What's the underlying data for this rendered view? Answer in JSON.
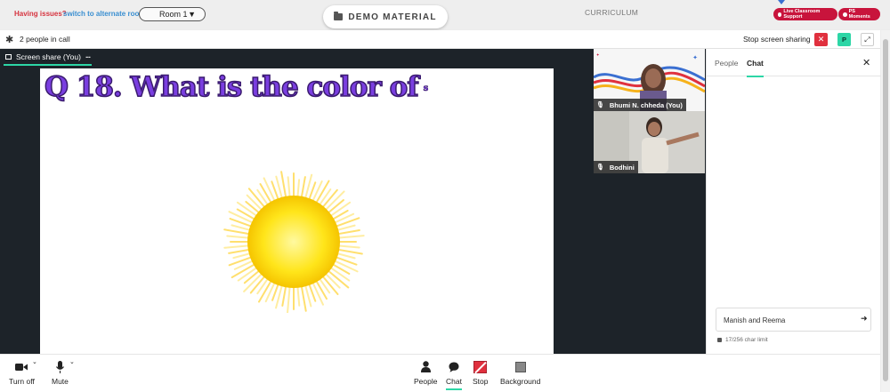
{
  "topbar": {
    "issues_text": "Having issues?",
    "alternate_room": "switch to alternate room",
    "room_select": "Room 1",
    "demo_material": "DEMO MATERIAL",
    "curriculum": "CURRICULUM",
    "live_support": "Live Classroom Support",
    "ps_moments": "PS Moments"
  },
  "callbar": {
    "people_in_call": "2 people in call",
    "stop_screen_sharing": "Stop screen sharing",
    "avatar_initial": "P"
  },
  "stage": {
    "share_tab": "Screen share (You)",
    "more": "···",
    "slide_question": "Q 18. What is the color of",
    "slide_tail": "s"
  },
  "participants": [
    {
      "name": "Bhumi N. chheda (You)"
    },
    {
      "name": "Bodhini"
    }
  ],
  "chat_panel": {
    "tab_people": "People",
    "tab_chat": "Chat",
    "input_value": "Manish and Reema",
    "char_limit": "17/256 char limit"
  },
  "controls": {
    "turn_off": "Turn off",
    "mute": "Mute",
    "people": "People",
    "chat": "Chat",
    "stop": "Stop",
    "background": "Background"
  },
  "colors": {
    "accent": "#2dd6a6",
    "danger": "#e0303e",
    "brand": "#c8143c",
    "slide_text": "#7a3ee0"
  }
}
